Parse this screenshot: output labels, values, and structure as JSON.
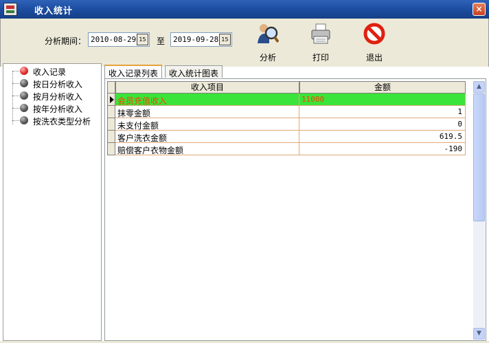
{
  "window": {
    "title": "收入统计",
    "close_label": "×"
  },
  "filter": {
    "period_label": "分析期间：",
    "start_date": "2010-08-29",
    "to_label": "至",
    "end_date": "2019-09-28",
    "calendar_glyph": "15"
  },
  "toolbar": {
    "analyze_label": "分析",
    "print_label": "打印",
    "exit_label": "退出"
  },
  "tree": {
    "items": [
      {
        "label": "收入记录",
        "selected": true
      },
      {
        "label": "按日分析收入",
        "selected": false
      },
      {
        "label": "按月分析收入",
        "selected": false
      },
      {
        "label": "按年分析收入",
        "selected": false
      },
      {
        "label": "按洗衣类型分析",
        "selected": false
      }
    ]
  },
  "tabs": [
    {
      "label": "收入记录列表",
      "active": true
    },
    {
      "label": "收入统计图表",
      "active": false
    }
  ],
  "grid": {
    "columns": [
      "收入项目",
      "金额"
    ],
    "rows": [
      {
        "name": "会员充值收入",
        "amount": "11000"
      },
      {
        "name": "抹零金额",
        "amount": "1"
      },
      {
        "name": "未支付金额",
        "amount": "0"
      },
      {
        "name": "客户洗衣金额",
        "amount": "619.5"
      },
      {
        "name": "赔偿客户衣物金额",
        "amount": "-190"
      }
    ]
  },
  "colors": {
    "titlebar": "#1d4fa3",
    "highlight_row_bg": "#3ae43a",
    "highlight_row_text": "#ff4000",
    "panel_bg": "#ece9d8"
  }
}
